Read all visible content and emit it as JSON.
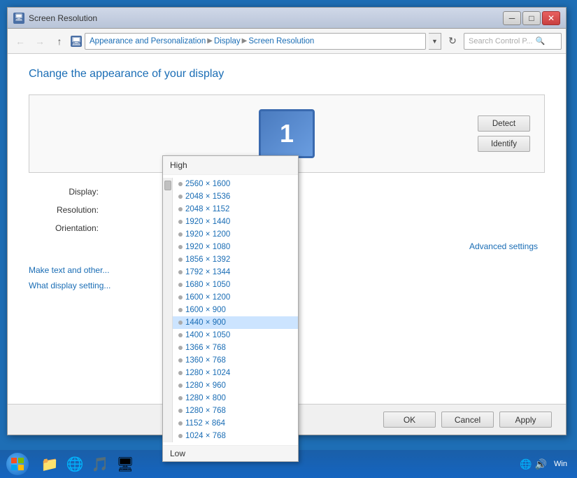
{
  "window": {
    "title": "Screen Resolution",
    "icon": "🖥"
  },
  "titlebar": {
    "minimize_label": "─",
    "restore_label": "□",
    "close_label": "✕"
  },
  "addressbar": {
    "back_tooltip": "Back",
    "forward_tooltip": "Forward",
    "up_tooltip": "Up",
    "path": {
      "part1": "Appearance and Personalization",
      "part2": "Display",
      "part3": "Screen Resolution"
    },
    "search_placeholder": "Search Control P...",
    "search_icon": "🔍",
    "refresh_icon": "↻"
  },
  "page": {
    "title": "Change the appearance of your display",
    "detect_button": "Detect",
    "identify_button": "Identify",
    "monitor_number": "1"
  },
  "settings": {
    "display_label": "Display:",
    "display_value": "",
    "resolution_label": "Resolution:",
    "resolution_value": "",
    "orientation_label": "Orientation:",
    "orientation_value": ""
  },
  "links": {
    "make_text": "Make text and other...",
    "what_display": "What display setting...",
    "advanced_settings": "Advanced settings"
  },
  "buttons": {
    "ok": "OK",
    "cancel": "Cancel",
    "apply": "Apply"
  },
  "resolution_dropdown": {
    "header": "High",
    "footer": "Low",
    "items": [
      "2560 × 1600",
      "2048 × 1536",
      "2048 × 1152",
      "1920 × 1440",
      "1920 × 1200",
      "1920 × 1080",
      "1856 × 1392",
      "1792 × 1344",
      "1680 × 1050",
      "1600 × 1200",
      "1600 × 900",
      "1440 × 900",
      "1400 × 1050",
      "1366 × 768",
      "1360 × 768",
      "1280 × 1024",
      "1280 × 960",
      "1280 × 800",
      "1280 × 768",
      "1152 × 864",
      "1024 × 768"
    ],
    "selected_index": 11
  },
  "taskbar": {
    "icons": [
      "🌐",
      "📁",
      "🎵",
      "🖥"
    ],
    "tray": {
      "network": "🌐",
      "volume": "🔊",
      "time": "Win"
    }
  }
}
